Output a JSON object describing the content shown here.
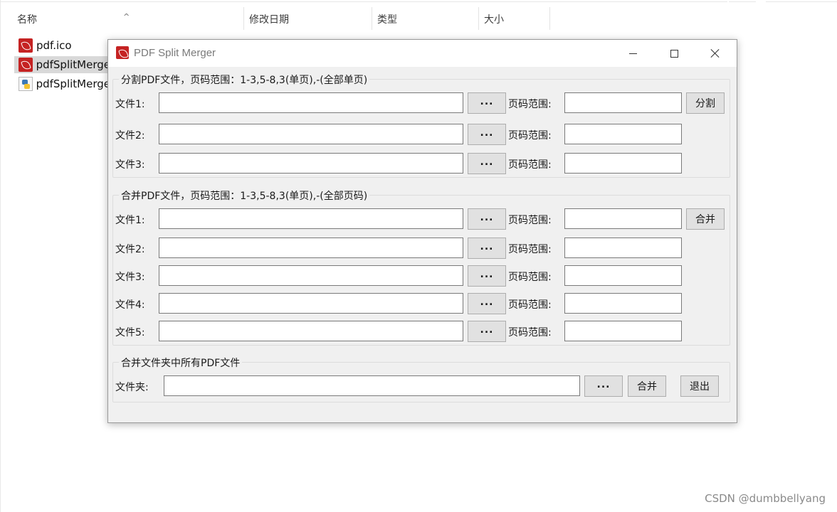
{
  "explorer": {
    "columns": {
      "name": "名称",
      "date_modified": "修改日期",
      "type": "类型",
      "size": "大小"
    },
    "files": [
      {
        "name": "pdf.ico",
        "icon": "pdf-icon"
      },
      {
        "name": "pdfSplitMerge",
        "icon": "pdf-icon",
        "selected": true
      },
      {
        "name": "pdfSplitMerge",
        "icon": "python-file-icon"
      }
    ],
    "watermark": "CSDN @dumbbellyang"
  },
  "window": {
    "title": "PDF Split Merger",
    "split_section": {
      "title": "分割PDF文件，页码范围：1-3,5-8,3(单页),-(全部单页)",
      "rows": [
        {
          "file_label": "文件1:",
          "file_value": "",
          "browse_label": "...",
          "range_label": "页码范围:",
          "range_value": ""
        },
        {
          "file_label": "文件2:",
          "file_value": "",
          "browse_label": "...",
          "range_label": "页码范围:",
          "range_value": ""
        },
        {
          "file_label": "文件3:",
          "file_value": "",
          "browse_label": "...",
          "range_label": "页码范围:",
          "range_value": ""
        }
      ],
      "action_label": "分割"
    },
    "merge_section": {
      "title": "合并PDF文件，页码范围：1-3,5-8,3(单页),-(全部页码)",
      "rows": [
        {
          "file_label": "文件1:",
          "file_value": "",
          "browse_label": "...",
          "range_label": "页码范围:",
          "range_value": ""
        },
        {
          "file_label": "文件2:",
          "file_value": "",
          "browse_label": "...",
          "range_label": "页码范围:",
          "range_value": ""
        },
        {
          "file_label": "文件3:",
          "file_value": "",
          "browse_label": "...",
          "range_label": "页码范围:",
          "range_value": ""
        },
        {
          "file_label": "文件4:",
          "file_value": "",
          "browse_label": "...",
          "range_label": "页码范围:",
          "range_value": ""
        },
        {
          "file_label": "文件5:",
          "file_value": "",
          "browse_label": "...",
          "range_label": "页码范围:",
          "range_value": ""
        }
      ],
      "action_label": "合并"
    },
    "folder_section": {
      "title": "合并文件夹中所有PDF文件",
      "folder_label": "文件夹:",
      "folder_value": "",
      "browse_label": "...",
      "merge_label": "合并",
      "exit_label": "退出"
    }
  }
}
